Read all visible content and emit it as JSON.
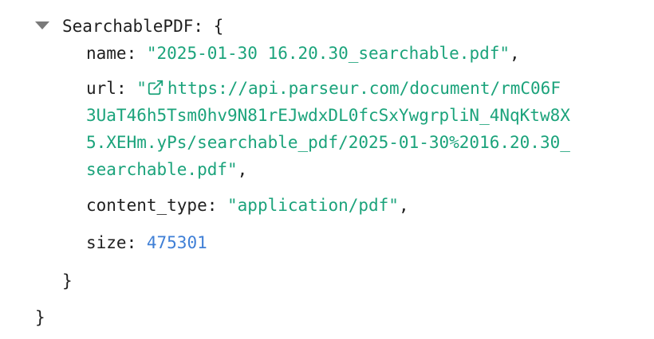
{
  "object": {
    "key": "SearchablePDF",
    "open": ": {",
    "close": "}",
    "fields": {
      "name": {
        "key": "name",
        "value": "\"2025-01-30 16.20.30_searchable.pdf\"",
        "trail": ","
      },
      "url": {
        "key": "url",
        "quote_open": "\"",
        "lines": [
          "https://api.parseur.com/document/rmC06F",
          "3UaT46h5Tsm0hv9N81rEJwdxDL0fcSxYwgrpliN_4NqKtw8X",
          "5.XEHm.yPs/searchable_pdf/2025-01-30%2016.20.30_",
          "searchable.pdf"
        ],
        "quote_close": "\"",
        "trail": ","
      },
      "content_type": {
        "key": "content_type",
        "value": "\"application/pdf\"",
        "trail": ","
      },
      "size": {
        "key": "size",
        "value": "475301"
      }
    }
  },
  "colors": {
    "string": "#1ba37b",
    "number": "#3f7fd6",
    "toggle": "#7a7a7a"
  },
  "icons": {
    "toggle": "triangle-down-icon",
    "external": "external-link-icon"
  }
}
